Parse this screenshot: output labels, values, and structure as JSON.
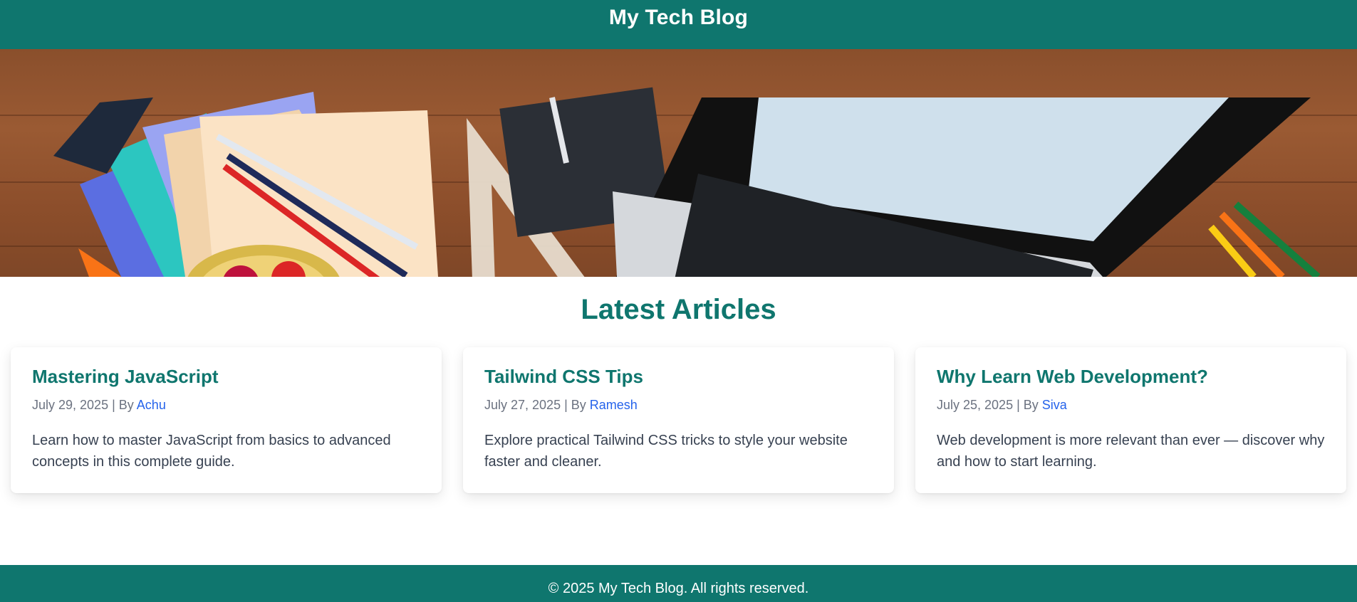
{
  "header": {
    "title": "My Tech Blog"
  },
  "hero": {
    "description": "desk with laptop, pencils, notebooks, strawberries and coffee"
  },
  "main": {
    "section_title": "Latest Articles",
    "articles": [
      {
        "title": "Mastering JavaScript",
        "date": "July 29, 2025",
        "by": "| By",
        "author": "Achu",
        "excerpt": "Learn how to master JavaScript from basics to advanced concepts in this complete guide."
      },
      {
        "title": "Tailwind CSS Tips",
        "date": "July 27, 2025",
        "by": "| By",
        "author": "Ramesh",
        "excerpt": "Explore practical Tailwind CSS tricks to style your website faster and cleaner."
      },
      {
        "title": "Why Learn Web Development?",
        "date": "July 25, 2025",
        "by": "| By",
        "author": "Siva",
        "excerpt": "Web development is more relevant than ever — discover why and how to start learning."
      }
    ]
  },
  "footer": {
    "text": "© 2025 My Tech Blog. All rights reserved."
  },
  "colors": {
    "brand": "#0f766e",
    "link": "#2563eb"
  }
}
